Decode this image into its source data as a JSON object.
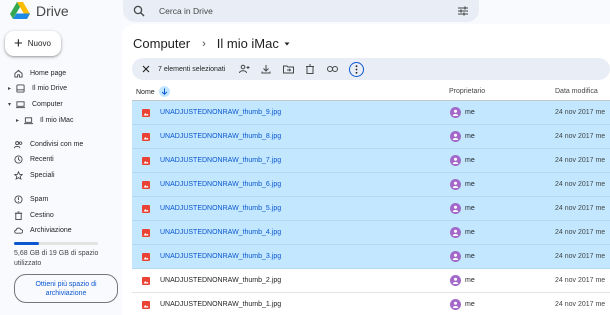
{
  "app": {
    "name": "Drive",
    "brand_colors": [
      "#1e88e5",
      "#34a853",
      "#fbbc04"
    ]
  },
  "search": {
    "placeholder": "Cerca in Drive"
  },
  "sidebar": {
    "new_label": "Nuovo",
    "items": [
      {
        "label": "Home page",
        "icon": "home-icon"
      },
      {
        "label": "Il mio Drive",
        "icon": "my-drive-icon"
      },
      {
        "label": "Computer",
        "icon": "computer-icon"
      },
      {
        "label": "Il mio iMac",
        "icon": "laptop-icon"
      },
      {
        "label": "Condivisi con me",
        "icon": "people-icon"
      },
      {
        "label": "Recenti",
        "icon": "clock-icon"
      },
      {
        "label": "Speciali",
        "icon": "star-icon"
      },
      {
        "label": "Spam",
        "icon": "spam-icon"
      },
      {
        "label": "Cestino",
        "icon": "trash-icon"
      },
      {
        "label": "Archiviazione",
        "icon": "cloud-icon"
      }
    ],
    "storage": {
      "text": "5,68 GB di 19 GB di spazio utilizzato",
      "used_fraction": 0.299
    },
    "upgrade_label": "Ottieni più spazio di archiviazione"
  },
  "breadcrumb": {
    "parent": "Computer",
    "current": "Il mio iMac"
  },
  "selection_bar": {
    "count_label": "7 elementi selezionati"
  },
  "table": {
    "headers": {
      "name": "Nome",
      "owner": "Proprietario",
      "date": "Data modifica"
    },
    "rows": [
      {
        "name": "UNADJUSTEDNONRAW_thumb_9.jpg",
        "owner": "me",
        "date": "24 nov 2017 me",
        "selected": true
      },
      {
        "name": "UNADJUSTEDNONRAW_thumb_8.jpg",
        "owner": "me",
        "date": "24 nov 2017 me",
        "selected": true
      },
      {
        "name": "UNADJUSTEDNONRAW_thumb_7.jpg",
        "owner": "me",
        "date": "24 nov 2017 me",
        "selected": true
      },
      {
        "name": "UNADJUSTEDNONRAW_thumb_6.jpg",
        "owner": "me",
        "date": "24 nov 2017 me",
        "selected": true
      },
      {
        "name": "UNADJUSTEDNONRAW_thumb_5.jpg",
        "owner": "me",
        "date": "24 nov 2017 me",
        "selected": true
      },
      {
        "name": "UNADJUSTEDNONRAW_thumb_4.jpg",
        "owner": "me",
        "date": "24 nov 2017 me",
        "selected": true
      },
      {
        "name": "UNADJUSTEDNONRAW_thumb_3.jpg",
        "owner": "me",
        "date": "24 nov 2017 me",
        "selected": true
      },
      {
        "name": "UNADJUSTEDNONRAW_thumb_2.jpg",
        "owner": "me",
        "date": "24 nov 2017 me",
        "selected": false
      },
      {
        "name": "UNADJUSTEDNONRAW_thumb_1.jpg",
        "owner": "me",
        "date": "24 nov 2017 me",
        "selected": false
      }
    ]
  }
}
